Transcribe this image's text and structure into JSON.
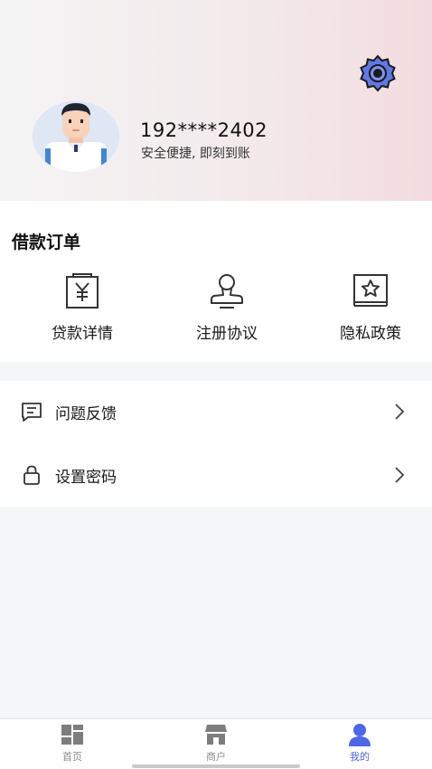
{
  "profile": {
    "phone": "192****2402",
    "slogan": "安全便捷, 即刻到账"
  },
  "orders": {
    "title": "借款订单",
    "items": [
      {
        "label": "贷款详情",
        "icon": "receipt-yen-icon"
      },
      {
        "label": "注册协议",
        "icon": "stamp-icon"
      },
      {
        "label": "隐私政策",
        "icon": "star-frame-icon"
      }
    ]
  },
  "menu": [
    {
      "label": "问题反馈",
      "icon": "message-icon"
    },
    {
      "label": "设置密码",
      "icon": "lock-icon"
    }
  ],
  "tabs": [
    {
      "label": "首页",
      "icon": "home-grid-icon",
      "active": false
    },
    {
      "label": "商户",
      "icon": "store-icon",
      "active": false
    },
    {
      "label": "我的",
      "icon": "user-icon",
      "active": true
    }
  ],
  "colors": {
    "accent": "#4e67e8",
    "header_gradient_end": "#f3dcdf",
    "tab_inactive": "#8a8a8a"
  }
}
